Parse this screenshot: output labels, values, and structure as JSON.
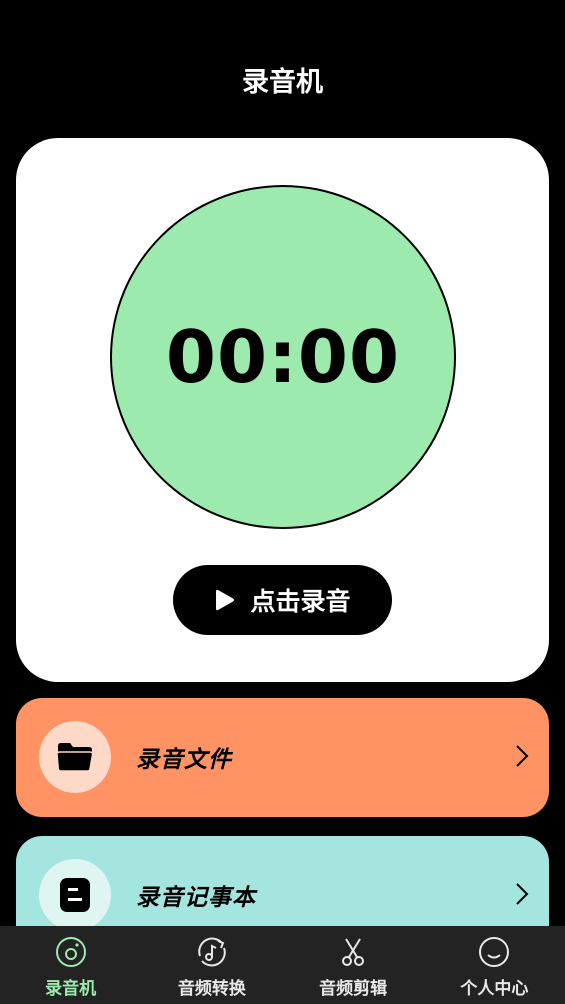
{
  "header": {
    "title": "录音机"
  },
  "recorder": {
    "timer": "00:00",
    "record_button_label": "点击录音"
  },
  "features": [
    {
      "label": "录音文件",
      "icon": "folder-icon",
      "color": "#ff9364"
    },
    {
      "label": "录音记事本",
      "icon": "notepad-icon",
      "color": "#a4e6df"
    }
  ],
  "tabbar": {
    "active_color": "#9deaaf",
    "tabs": [
      {
        "label": "录音机",
        "icon": "recorder-disc-icon",
        "active": true
      },
      {
        "label": "音频转换",
        "icon": "music-convert-icon",
        "active": false
      },
      {
        "label": "音频剪辑",
        "icon": "scissors-icon",
        "active": false
      },
      {
        "label": "个人中心",
        "icon": "smiley-icon",
        "active": false
      }
    ]
  }
}
